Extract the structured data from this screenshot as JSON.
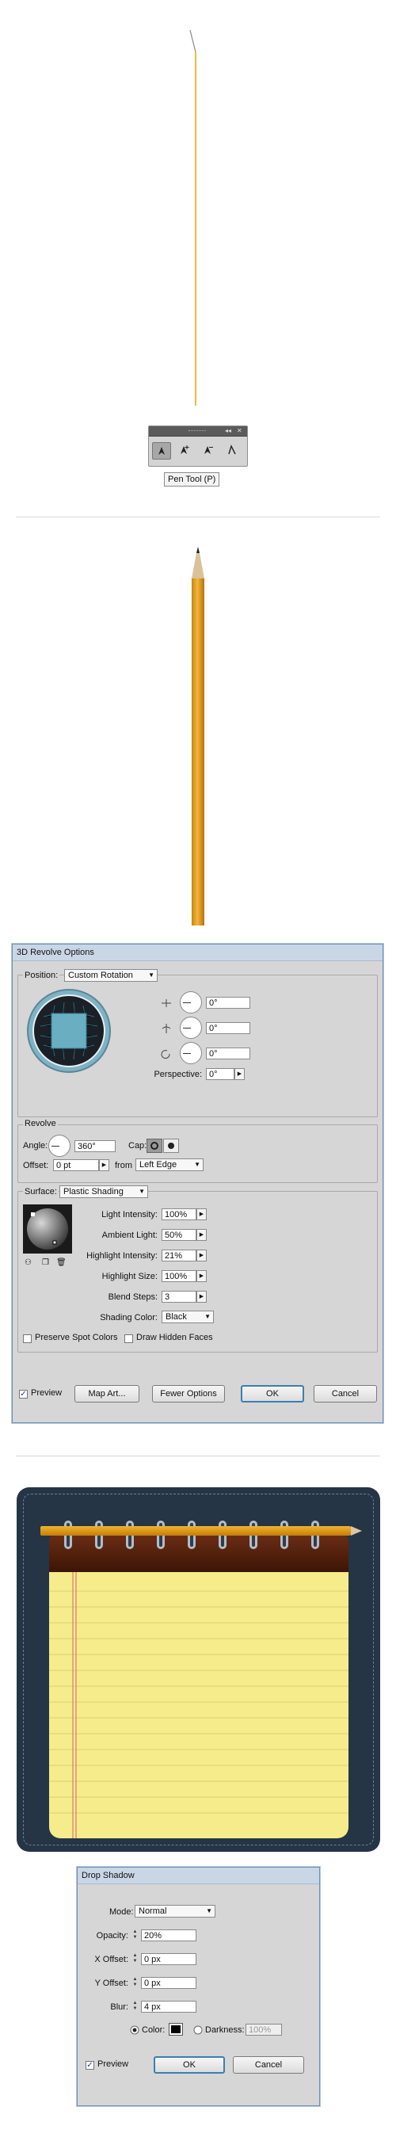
{
  "pen_tool": {
    "tooltip": "Pen Tool (P)",
    "tools": [
      "pen-icon",
      "add-anchor-point-icon",
      "delete-anchor-point-icon",
      "convert-anchor-point-icon"
    ],
    "colors": {
      "path_line": "#f2a400"
    }
  },
  "revolve_dialog": {
    "title": "3D Revolve Options",
    "position_label": "Position:",
    "position_value": "Custom Rotation",
    "rotation": {
      "x_value": "0°",
      "y_value": "0°",
      "z_value": "0°"
    },
    "perspective_label": "Perspective:",
    "perspective_value": "0°",
    "revolve_group_label": "Revolve",
    "angle_label": "Angle:",
    "angle_value": "360°",
    "cap_label": "Cap:",
    "offset_label": "Offset:",
    "offset_value": "0 pt",
    "from_label": "from",
    "from_value": "Left Edge",
    "surface_label": "Surface:",
    "surface_value": "Plastic Shading",
    "light_intensity_label": "Light Intensity:",
    "light_intensity_value": "100%",
    "ambient_light_label": "Ambient Light:",
    "ambient_light_value": "50%",
    "highlight_intensity_label": "Highlight Intensity:",
    "highlight_intensity_value": "21%",
    "highlight_size_label": "Highlight Size:",
    "highlight_size_value": "100%",
    "blend_steps_label": "Blend Steps:",
    "blend_steps_value": "3",
    "shading_color_label": "Shading Color:",
    "shading_color_value": "Black",
    "preserve_spot_label": "Preserve Spot Colors",
    "draw_hidden_label": "Draw Hidden Faces",
    "preview_label": "Preview",
    "map_art_label": "Map Art...",
    "fewer_options_label": "Fewer Options",
    "ok_label": "OK",
    "cancel_label": "Cancel"
  },
  "drop_shadow_dialog": {
    "title": "Drop Shadow",
    "mode_label": "Mode:",
    "mode_value": "Normal",
    "opacity_label": "Opacity:",
    "opacity_value": "20%",
    "x_offset_label": "X Offset:",
    "x_offset_value": "0 px",
    "y_offset_label": "Y Offset:",
    "y_offset_value": "0 px",
    "blur_label": "Blur:",
    "blur_value": "4 px",
    "color_label": "Color:",
    "darkness_label": "Darkness:",
    "darkness_value": "100%",
    "preview_label": "Preview",
    "ok_label": "OK",
    "cancel_label": "Cancel"
  },
  "colors": {
    "pencil_body": "#e0a02a",
    "notepad_cover": "#253545",
    "notepad_paper": "#f6ec8c",
    "notepad_binding": "#5a2410",
    "dialog_bg": "#d6d6d6",
    "shadow_color": "#000000"
  }
}
